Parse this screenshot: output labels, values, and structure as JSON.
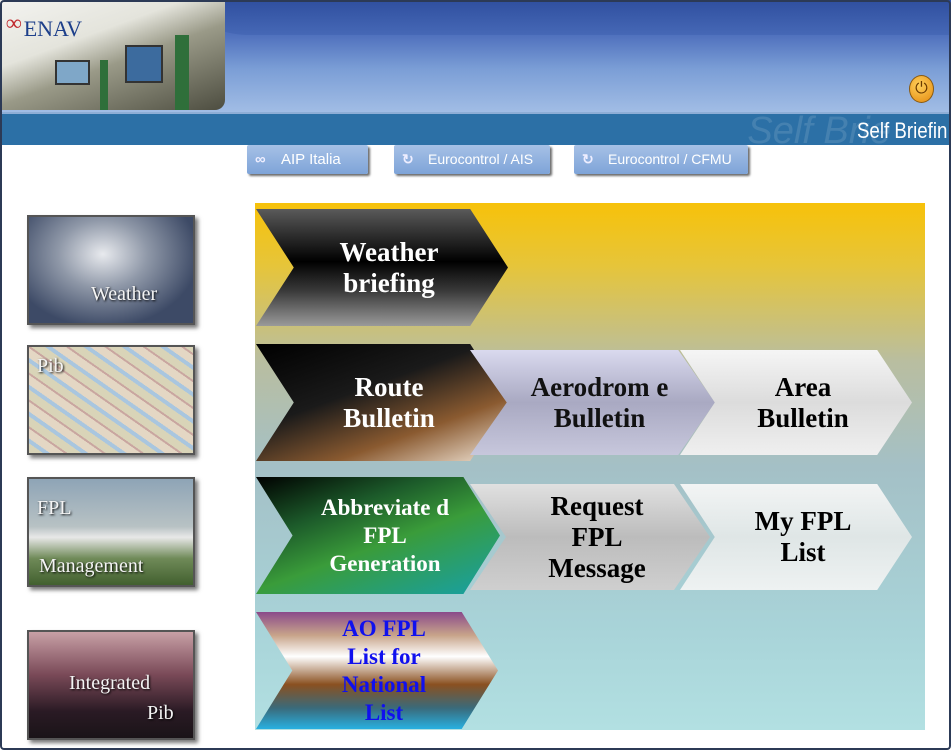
{
  "header": {
    "logo_text": "ENAV",
    "title": "Self Briefin",
    "title_ghost": "Self Brie",
    "power_icon": "power-icon"
  },
  "links": [
    {
      "label": "AIP Italia",
      "icon": "enav-logo-icon"
    },
    {
      "label": "Eurocontrol / AIS",
      "icon": "eurocontrol-icon"
    },
    {
      "label": "Eurocontrol / CFMU",
      "icon": "eurocontrol-icon"
    }
  ],
  "tiles": [
    {
      "label": "Weather"
    },
    {
      "label": "Pib"
    },
    {
      "label_1": "FPL",
      "label_2": "Management"
    },
    {
      "label_1": "Integrated",
      "label_2": "Pib"
    }
  ],
  "chevrons": {
    "weather": "Weather briefing",
    "route": "Route Bulletin",
    "aerodrome": "Aerodrom e Bulletin",
    "area": "Area Bulletin",
    "abbreviated": "Abbreviate d FPL Generation",
    "request": "Request FPL Message",
    "myfpl": "My FPL List",
    "ao": "AO FPL List for National List"
  },
  "colors": {
    "banner": "#4f70bd",
    "titlebar": "#2c70a6",
    "ao_text": "#1010ee"
  }
}
